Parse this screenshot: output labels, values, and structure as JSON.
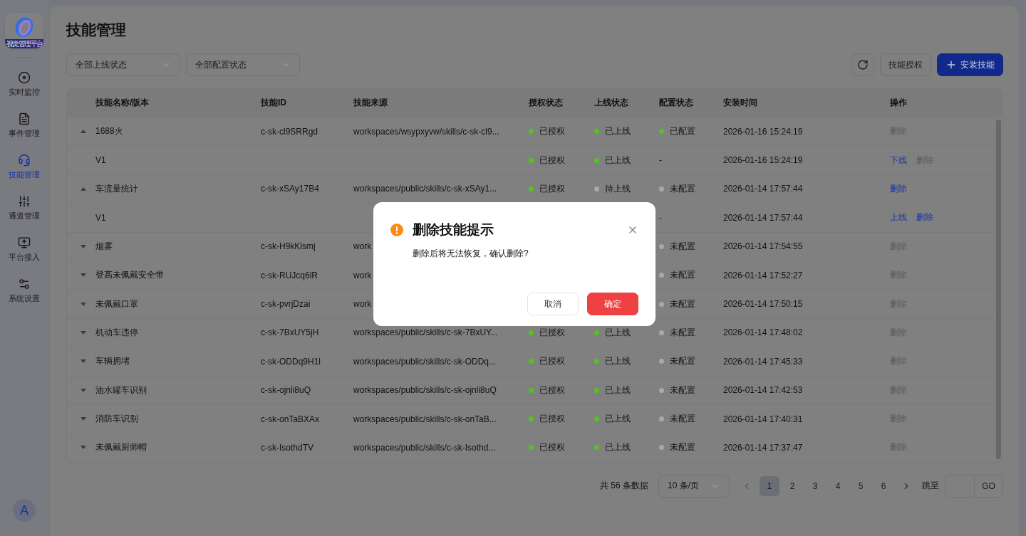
{
  "logo": {
    "caption": "视觉管理平台"
  },
  "sidebar": {
    "items": [
      {
        "label": "实时监控",
        "selected": false
      },
      {
        "label": "事件管理",
        "selected": false
      },
      {
        "label": "技能管理",
        "selected": true
      },
      {
        "label": "通道管理",
        "selected": false
      },
      {
        "label": "平台接入",
        "selected": false
      },
      {
        "label": "系统设置",
        "selected": false
      }
    ],
    "avatar": "A"
  },
  "page_title": "技能管理",
  "filters": [
    "全部上线状态",
    "全部配置状态"
  ],
  "toolbar": {
    "authorize": "技能授权",
    "install": "安装技能"
  },
  "table": {
    "columns": [
      "技能名称/版本",
      "技能ID",
      "技能来源",
      "授权状态",
      "上线状态",
      "配置状态",
      "安装时间",
      "操作"
    ],
    "rows": [
      {
        "kind": "skill",
        "expanded": true,
        "name": "1688火",
        "id": "c-sk-cl9SRRgd",
        "source": "workspaces/wsypxyvw/skills/c-sk-cl9...",
        "auth": {
          "label": "已授权",
          "color": "#52c41a"
        },
        "online": {
          "label": "已上线",
          "color": "#52c41a"
        },
        "config": {
          "label": "已配置",
          "color": "#52c41a"
        },
        "time": "2026-01-16 15:24:19",
        "actions": [
          {
            "label": "删除",
            "disabled": true
          }
        ]
      },
      {
        "kind": "version",
        "name": "V1",
        "auth": {
          "label": "已授权",
          "color": "#52c41a"
        },
        "online": {
          "label": "已上线",
          "color": "#52c41a"
        },
        "config": {
          "label": "-"
        },
        "time": "2026-01-16 15:24:19",
        "actions": [
          {
            "label": "下线",
            "disabled": false
          },
          {
            "label": "删除",
            "disabled": true
          }
        ]
      },
      {
        "kind": "skill",
        "expanded": true,
        "name": "车流量统计",
        "id": "c-sk-xSAy17B4",
        "source": "workspaces/public/skills/c-sk-xSAy1...",
        "auth": {
          "label": "已授权",
          "color": "#52c41a"
        },
        "online": {
          "label": "待上线",
          "color": "#a3a9b3"
        },
        "config": {
          "label": "未配置",
          "color": "#a3a9b3"
        },
        "time": "2026-01-14 17:57:44",
        "actions": [
          {
            "label": "删除",
            "disabled": false
          }
        ]
      },
      {
        "kind": "version",
        "name": "V1",
        "config": {
          "label": "-"
        },
        "time": "2026-01-14 17:57:44",
        "actions": [
          {
            "label": "上线",
            "disabled": false
          },
          {
            "label": "删除",
            "disabled": false
          }
        ]
      },
      {
        "kind": "skill",
        "expanded": false,
        "name": "烟雾",
        "id": "c-sk-H9kKlsmj",
        "source": "work",
        "config": {
          "label": "未配置",
          "color": "#a3a9b3"
        },
        "time": "2026-01-14 17:54:55",
        "actions": [
          {
            "label": "删除",
            "disabled": true
          }
        ]
      },
      {
        "kind": "skill",
        "expanded": false,
        "name": "登高未佩戴安全带",
        "id": "c-sk-RUJcq6lR",
        "source": "work",
        "config": {
          "label": "未配置",
          "color": "#a3a9b3"
        },
        "time": "2026-01-14 17:52:27",
        "actions": [
          {
            "label": "删除",
            "disabled": true
          }
        ]
      },
      {
        "kind": "skill",
        "expanded": false,
        "name": "未佩戴口罩",
        "id": "c-sk-pvrjDzai",
        "source": "work",
        "config": {
          "label": "未配置",
          "color": "#a3a9b3"
        },
        "time": "2026-01-14 17:50:15",
        "actions": [
          {
            "label": "删除",
            "disabled": true
          }
        ]
      },
      {
        "kind": "skill",
        "expanded": false,
        "name": "机动车违停",
        "id": "c-sk-7BxUY5jH",
        "source": "workspaces/public/skills/c-sk-7BxUY...",
        "auth": {
          "label": "已授权",
          "color": "#52c41a"
        },
        "online": {
          "label": "已上线",
          "color": "#52c41a"
        },
        "config": {
          "label": "未配置",
          "color": "#a3a9b3"
        },
        "time": "2026-01-14 17:48:02",
        "actions": [
          {
            "label": "删除",
            "disabled": true
          }
        ]
      },
      {
        "kind": "skill",
        "expanded": false,
        "name": "车辆拥堵",
        "id": "c-sk-ODDq9H1l",
        "source": "workspaces/public/skills/c-sk-ODDq...",
        "auth": {
          "label": "已授权",
          "color": "#52c41a"
        },
        "online": {
          "label": "已上线",
          "color": "#52c41a"
        },
        "config": {
          "label": "未配置",
          "color": "#a3a9b3"
        },
        "time": "2026-01-14 17:45:33",
        "actions": [
          {
            "label": "删除",
            "disabled": true
          }
        ]
      },
      {
        "kind": "skill",
        "expanded": false,
        "name": "油水罐车识别",
        "id": "c-sk-ojnli8uQ",
        "source": "workspaces/public/skills/c-sk-ojnli8uQ",
        "auth": {
          "label": "已授权",
          "color": "#52c41a"
        },
        "online": {
          "label": "已上线",
          "color": "#52c41a"
        },
        "config": {
          "label": "未配置",
          "color": "#a3a9b3"
        },
        "time": "2026-01-14 17:42:53",
        "actions": [
          {
            "label": "删除",
            "disabled": true
          }
        ]
      },
      {
        "kind": "skill",
        "expanded": false,
        "name": "消防车识别",
        "id": "c-sk-onTaBXAx",
        "source": "workspaces/public/skills/c-sk-onTaB...",
        "auth": {
          "label": "已授权",
          "color": "#52c41a"
        },
        "online": {
          "label": "已上线",
          "color": "#52c41a"
        },
        "config": {
          "label": "未配置",
          "color": "#a3a9b3"
        },
        "time": "2026-01-14 17:40:31",
        "actions": [
          {
            "label": "删除",
            "disabled": true
          }
        ]
      },
      {
        "kind": "skill",
        "expanded": false,
        "name": "未佩戴厨师帽",
        "id": "c-sk-IsothdTV",
        "source": "workspaces/public/skills/c-sk-Isothd...",
        "auth": {
          "label": "已授权",
          "color": "#52c41a"
        },
        "online": {
          "label": "已上线",
          "color": "#52c41a"
        },
        "config": {
          "label": "未配置",
          "color": "#a3a9b3"
        },
        "time": "2026-01-14 17:37:47",
        "actions": [
          {
            "label": "删除",
            "disabled": true
          }
        ]
      }
    ]
  },
  "pagination": {
    "total": "共 56 条数据",
    "page_size": "10 条/页",
    "pages": [
      {
        "label": "1",
        "selected": true
      },
      {
        "label": "2",
        "selected": false
      },
      {
        "label": "3",
        "selected": false
      },
      {
        "label": "4",
        "selected": false
      },
      {
        "label": "5",
        "selected": false
      },
      {
        "label": "6",
        "selected": false
      }
    ],
    "jump_label": "跳至",
    "go": "GO"
  },
  "dialog": {
    "title": "删除技能提示",
    "message": "删除后将无法恢复，确认删除?",
    "buttons": [
      {
        "kind": "cancel",
        "label": "取消"
      },
      {
        "kind": "confirm",
        "label": "确定"
      }
    ]
  }
}
